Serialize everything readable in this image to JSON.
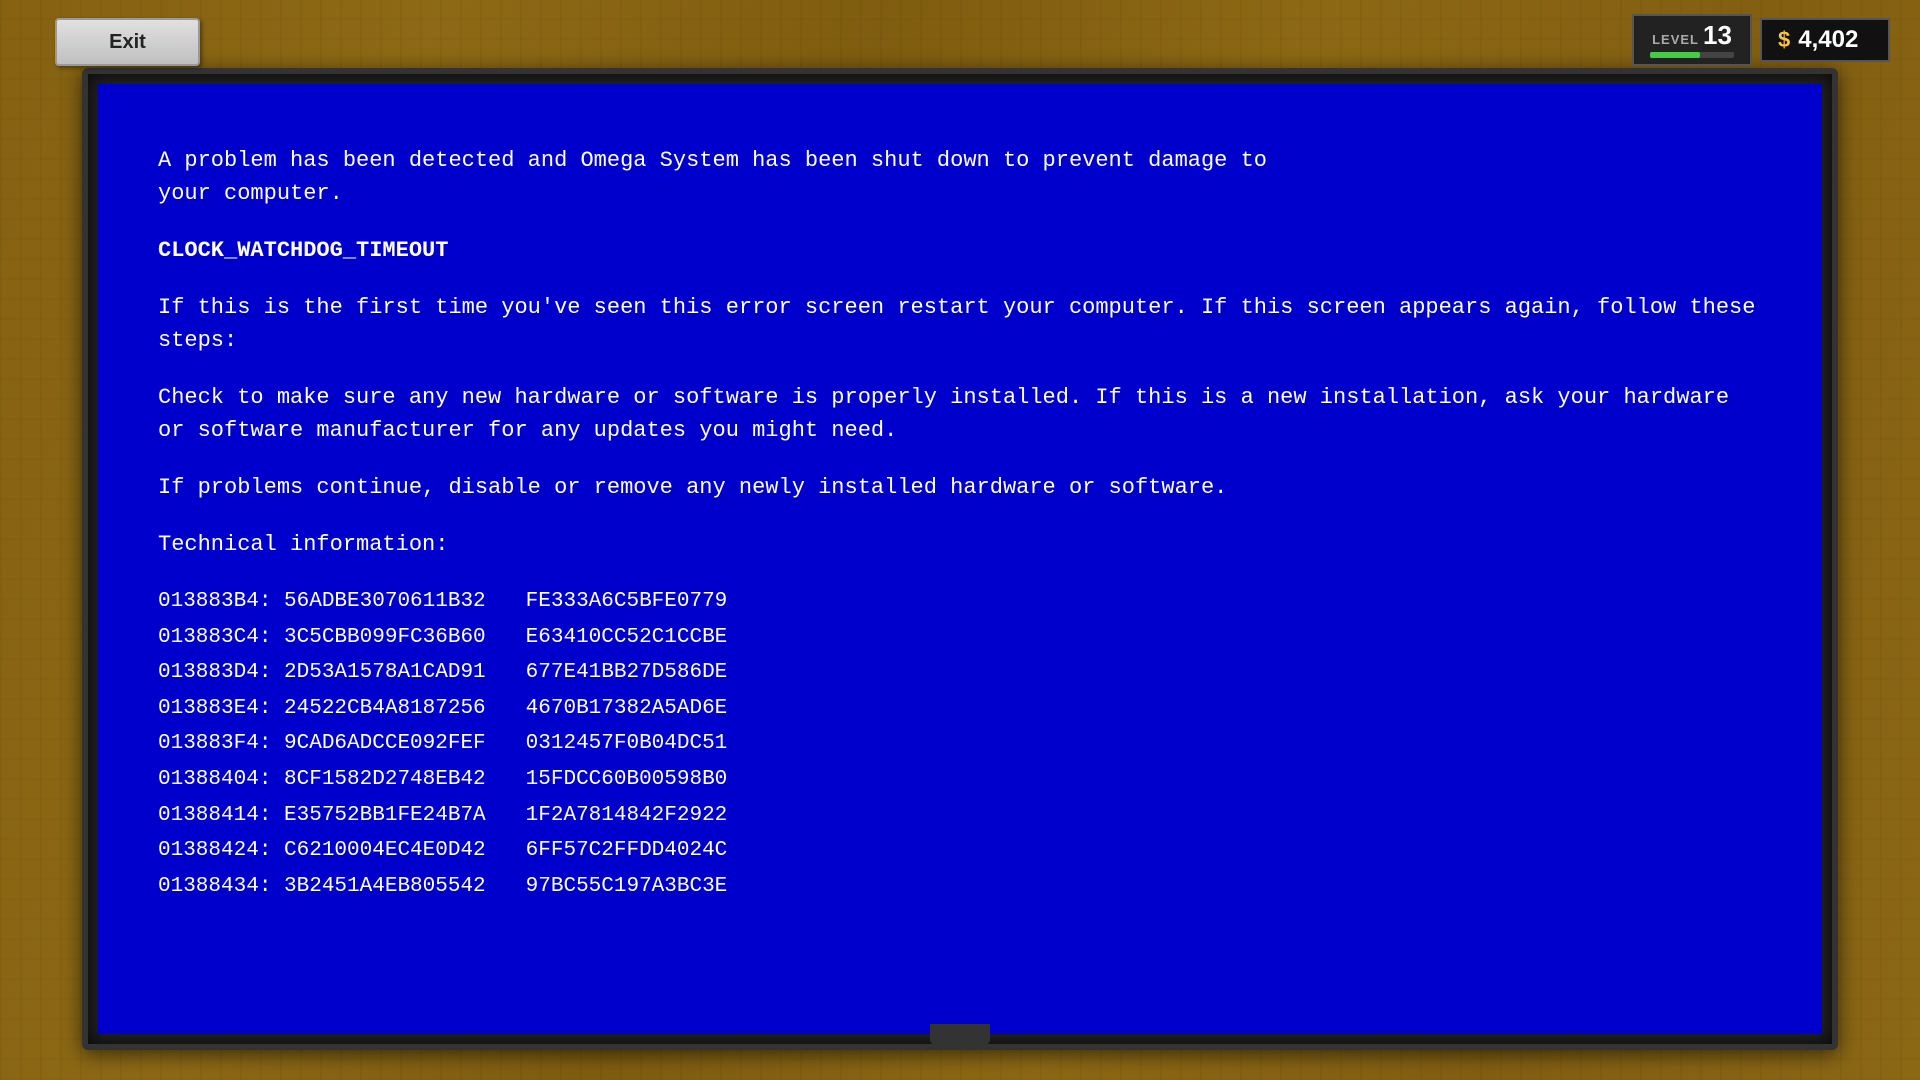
{
  "exit_button": {
    "label": "Exit"
  },
  "hud": {
    "level_label": "LEVEL",
    "level_number": "13",
    "level_progress": 60,
    "money_icon": "$",
    "money_amount": "4,402"
  },
  "bsod": {
    "line1": "A problem has been detected and Omega System has been shut down to prevent damage to",
    "line2": "your computer.",
    "error_code": "CLOCK_WATCHDOG_TIMEOUT",
    "para1": "If this is the first time you've seen this error screen restart your computer. If this screen appears again, follow these steps:",
    "para2": "Check to make sure any new hardware or software is properly installed. If this is a new installation, ask your hardware or software manufacturer for any updates you might need.",
    "para3": "If problems continue, disable or remove any newly installed hardware or software.",
    "tech_header": "Technical information:",
    "tech_rows": [
      {
        "addr": "013883B4: 56ADBE3070611B32",
        "val": "FE333A6C5BFE0779"
      },
      {
        "addr": "013883C4: 3C5CBB099FC36B60",
        "val": "E63410CC52C1CCBE"
      },
      {
        "addr": "013883D4: 2D53A1578A1CAD91",
        "val": "677E41BB27D586DE"
      },
      {
        "addr": "013883E4: 24522CB4A8187256",
        "val": "4670B17382A5AD6E"
      },
      {
        "addr": "013883F4: 9CAD6ADCCE092FEF",
        "val": "0312457F0B04DC51"
      },
      {
        "addr": "01388404: 8CF1582D2748EB42",
        "val": "15FDCC60B00598B0"
      },
      {
        "addr": "01388414: E35752BB1FE24B7A",
        "val": "1F2A7814842F2922"
      },
      {
        "addr": "01388424: C6210004EC4E0D42",
        "val": "6FF57C2FFDD4024C"
      },
      {
        "addr": "01388434: 3B2451A4EB805542",
        "val": "97BC55C197A3BC3E"
      }
    ]
  },
  "colors": {
    "bsod_bg": "#0000CC",
    "exit_bg": "#d0d0d0",
    "hud_bg": "#1a1a1a",
    "level_bar": "#44cc44"
  }
}
